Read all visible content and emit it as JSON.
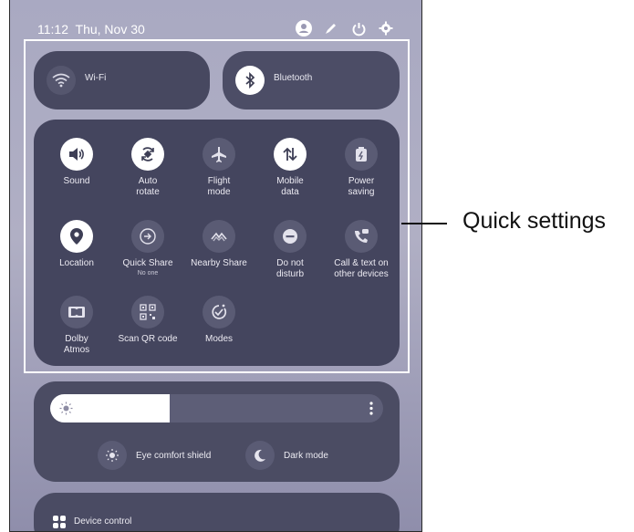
{
  "status_bar": {
    "time": "11:12",
    "date": "Thu, Nov 30",
    "icons": [
      "user-icon",
      "edit-icon",
      "power-icon",
      "settings-icon"
    ]
  },
  "top_tiles": {
    "wifi": {
      "label": "Wi-Fi",
      "icon": "wifi-icon",
      "state": "off"
    },
    "bluetooth": {
      "label": "Bluetooth",
      "icon": "bluetooth-icon",
      "state": "on"
    }
  },
  "quick_tiles": [
    {
      "label": "Sound",
      "sub": "",
      "icon": "volume-icon",
      "on": true
    },
    {
      "label": "Auto\nrotate",
      "sub": "",
      "icon": "rotate-icon",
      "on": true
    },
    {
      "label": "Flight\nmode",
      "sub": "",
      "icon": "airplane-icon",
      "on": false
    },
    {
      "label": "Mobile\ndata",
      "sub": "",
      "icon": "mobile-data-icon",
      "on": true
    },
    {
      "label": "Power\nsaving",
      "sub": "",
      "icon": "battery-icon",
      "on": false
    },
    {
      "label": "Location",
      "sub": "",
      "icon": "location-icon",
      "on": true
    },
    {
      "label": "Quick Share",
      "sub": "No one",
      "icon": "quick-share-icon",
      "on": false
    },
    {
      "label": "Nearby Share",
      "sub": "",
      "icon": "nearby-share-icon",
      "on": false
    },
    {
      "label": "Do not\ndisturb",
      "sub": "",
      "icon": "dnd-icon",
      "on": false
    },
    {
      "label": "Call & text on\nother devices",
      "sub": "",
      "icon": "call-text-icon",
      "on": false
    },
    {
      "label": "Dolby\nAtmos",
      "sub": "",
      "icon": "dolby-icon",
      "on": false
    },
    {
      "label": "Scan QR code",
      "sub": "",
      "icon": "qr-icon",
      "on": false
    },
    {
      "label": "Modes",
      "sub": "",
      "icon": "modes-icon",
      "on": false
    }
  ],
  "brightness": {
    "level": 0.36
  },
  "chips": {
    "eye_comfort": "Eye comfort shield",
    "dark_mode": "Dark mode"
  },
  "device_control": {
    "label": "Device control"
  },
  "callout": {
    "label": "Quick settings"
  },
  "colors": {
    "panel": "#44455e",
    "active_circle": "#ffffff",
    "inactive_circle": "#5a5b74"
  }
}
